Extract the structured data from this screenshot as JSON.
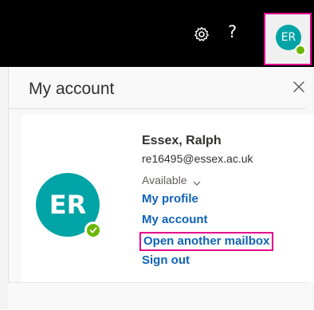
{
  "header": {
    "settings_icon": "gear-icon",
    "help_label": "?",
    "avatar_initials": "ER",
    "presence_color": "#6bb700",
    "accent_highlight": "#e3008c"
  },
  "panel": {
    "title": "My account",
    "close_icon": "close-icon"
  },
  "account": {
    "avatar_initials": "ER",
    "avatar_color": "#00a4a6",
    "presence_icon": "check-icon",
    "name": "Essex, Ralph",
    "email": "re16495@essex.ac.uk",
    "status": "Available",
    "links": {
      "my_profile": "My profile",
      "my_account": "My account",
      "open_another_mailbox": "Open another mailbox",
      "sign_out": "Sign out"
    },
    "link_color": "#0f62b5"
  }
}
